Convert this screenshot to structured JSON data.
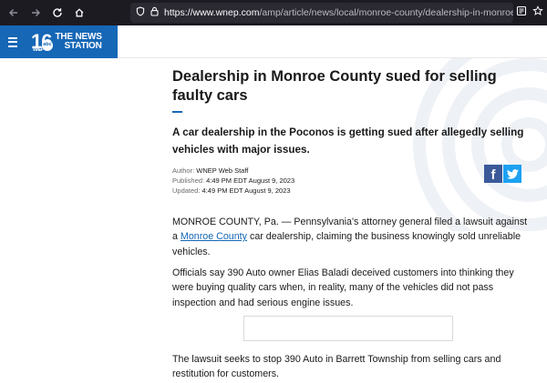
{
  "browser": {
    "url_host": "https://www.wnep.com",
    "url_path": "/amp/article/news/local/monroe-county/dealership-in-monroe-county-",
    "icons": [
      "back-arrow-icon",
      "forward-arrow-icon",
      "reload-icon",
      "home-icon",
      "shield-icon",
      "lock-icon",
      "reader-view-icon",
      "star-icon"
    ]
  },
  "header": {
    "logo_number": "16",
    "logo_network": "abc",
    "logo_line1": "THE NEWS",
    "logo_line2": "STATION",
    "logo_callsign": "WNEP",
    "brand_color": "#1667b6",
    "menu_icon": "hamburger-menu-icon"
  },
  "article": {
    "headline": "Dealership in Monroe County sued for selling faulty cars",
    "subhead": "A car dealership in the Poconos is getting sued after allegedly selling vehicles with major issues.",
    "author_label": "Author:",
    "author": "WNEP Web Staff",
    "published_label": "Published:",
    "published": "4:49 PM EDT August 9, 2023",
    "updated_label": "Updated:",
    "updated": "4:49 PM EDT August 9, 2023",
    "share": {
      "facebook_glyph": "f",
      "facebook_color": "#3b5998",
      "twitter_color": "#1da1f2"
    },
    "p1_before": "MONROE COUNTY, Pa. — Pennsylvania's attorney general filed a lawsuit against a ",
    "p1_link": "Monroe County",
    "p1_after": " car dealership, claiming the business knowingly sold unreliable vehicles.",
    "p2": "Officials say 390 Auto owner Elias Baladi deceived customers into thinking they were buying quality cars when, in reality, many of the vehicles did not pass inspection and had serious engine issues.",
    "p3": "The lawsuit seeks to stop 390 Auto in Barrett Township from selling cars and restitution for customers."
  }
}
